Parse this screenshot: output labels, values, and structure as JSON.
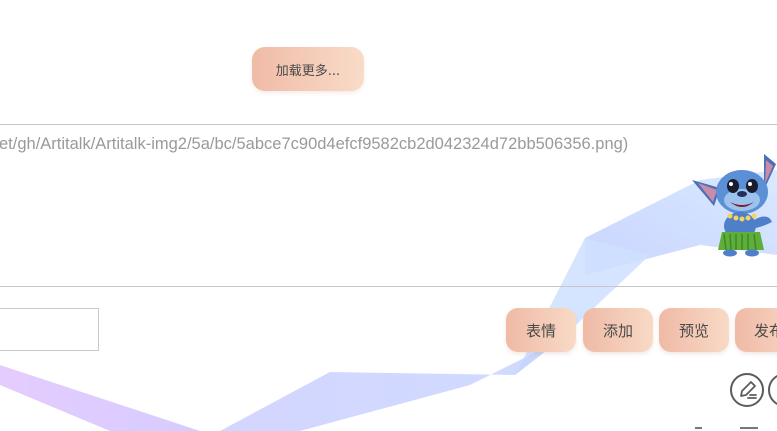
{
  "load_more": {
    "label": "加载更多..."
  },
  "editor": {
    "content": "et/gh/Artitalk/Artitalk-img2/5a/bc/5abce7c90d4efcf9582cb2d042324d72bb506356.png)"
  },
  "nickname_input": {
    "value": ""
  },
  "actions": {
    "emoji_label": "表情",
    "add_label": "添加",
    "preview_label": "预览",
    "publish_label": "发布"
  },
  "icons": {
    "edit_icon": "edit-icon",
    "other_icon": "circle-icon",
    "mascot": "stitch-mascot"
  },
  "colors": {
    "button_gradient_start": "#efbaa6",
    "button_gradient_end": "#f8dac6",
    "text": "#4a4a4a",
    "placeholder_text": "#9a9a9a",
    "ribbon_blue": "#c9dcff",
    "ribbon_purple": "#dcc5ff"
  }
}
